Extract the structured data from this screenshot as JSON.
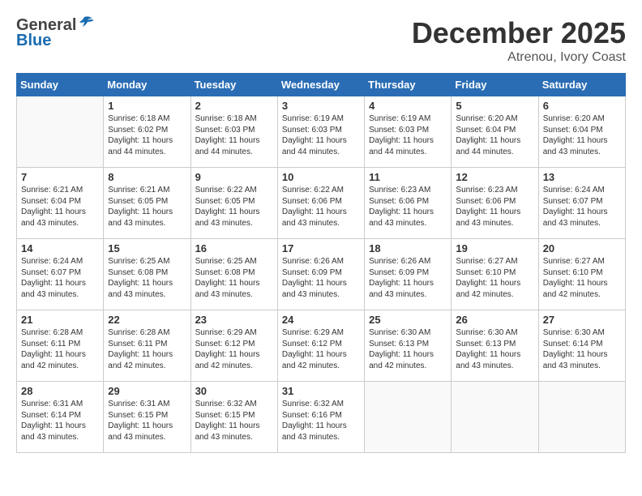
{
  "header": {
    "logo_general": "General",
    "logo_blue": "Blue",
    "month_title": "December 2025",
    "location": "Atrenou, Ivory Coast"
  },
  "days_of_week": [
    "Sunday",
    "Monday",
    "Tuesday",
    "Wednesday",
    "Thursday",
    "Friday",
    "Saturday"
  ],
  "weeks": [
    [
      {
        "day": "",
        "info": ""
      },
      {
        "day": "1",
        "info": "Sunrise: 6:18 AM\nSunset: 6:02 PM\nDaylight: 11 hours and 44 minutes."
      },
      {
        "day": "2",
        "info": "Sunrise: 6:18 AM\nSunset: 6:03 PM\nDaylight: 11 hours and 44 minutes."
      },
      {
        "day": "3",
        "info": "Sunrise: 6:19 AM\nSunset: 6:03 PM\nDaylight: 11 hours and 44 minutes."
      },
      {
        "day": "4",
        "info": "Sunrise: 6:19 AM\nSunset: 6:03 PM\nDaylight: 11 hours and 44 minutes."
      },
      {
        "day": "5",
        "info": "Sunrise: 6:20 AM\nSunset: 6:04 PM\nDaylight: 11 hours and 44 minutes."
      },
      {
        "day": "6",
        "info": "Sunrise: 6:20 AM\nSunset: 6:04 PM\nDaylight: 11 hours and 43 minutes."
      }
    ],
    [
      {
        "day": "7",
        "info": "Sunrise: 6:21 AM\nSunset: 6:04 PM\nDaylight: 11 hours and 43 minutes."
      },
      {
        "day": "8",
        "info": "Sunrise: 6:21 AM\nSunset: 6:05 PM\nDaylight: 11 hours and 43 minutes."
      },
      {
        "day": "9",
        "info": "Sunrise: 6:22 AM\nSunset: 6:05 PM\nDaylight: 11 hours and 43 minutes."
      },
      {
        "day": "10",
        "info": "Sunrise: 6:22 AM\nSunset: 6:06 PM\nDaylight: 11 hours and 43 minutes."
      },
      {
        "day": "11",
        "info": "Sunrise: 6:23 AM\nSunset: 6:06 PM\nDaylight: 11 hours and 43 minutes."
      },
      {
        "day": "12",
        "info": "Sunrise: 6:23 AM\nSunset: 6:06 PM\nDaylight: 11 hours and 43 minutes."
      },
      {
        "day": "13",
        "info": "Sunrise: 6:24 AM\nSunset: 6:07 PM\nDaylight: 11 hours and 43 minutes."
      }
    ],
    [
      {
        "day": "14",
        "info": "Sunrise: 6:24 AM\nSunset: 6:07 PM\nDaylight: 11 hours and 43 minutes."
      },
      {
        "day": "15",
        "info": "Sunrise: 6:25 AM\nSunset: 6:08 PM\nDaylight: 11 hours and 43 minutes."
      },
      {
        "day": "16",
        "info": "Sunrise: 6:25 AM\nSunset: 6:08 PM\nDaylight: 11 hours and 43 minutes."
      },
      {
        "day": "17",
        "info": "Sunrise: 6:26 AM\nSunset: 6:09 PM\nDaylight: 11 hours and 43 minutes."
      },
      {
        "day": "18",
        "info": "Sunrise: 6:26 AM\nSunset: 6:09 PM\nDaylight: 11 hours and 43 minutes."
      },
      {
        "day": "19",
        "info": "Sunrise: 6:27 AM\nSunset: 6:10 PM\nDaylight: 11 hours and 42 minutes."
      },
      {
        "day": "20",
        "info": "Sunrise: 6:27 AM\nSunset: 6:10 PM\nDaylight: 11 hours and 42 minutes."
      }
    ],
    [
      {
        "day": "21",
        "info": "Sunrise: 6:28 AM\nSunset: 6:11 PM\nDaylight: 11 hours and 42 minutes."
      },
      {
        "day": "22",
        "info": "Sunrise: 6:28 AM\nSunset: 6:11 PM\nDaylight: 11 hours and 42 minutes."
      },
      {
        "day": "23",
        "info": "Sunrise: 6:29 AM\nSunset: 6:12 PM\nDaylight: 11 hours and 42 minutes."
      },
      {
        "day": "24",
        "info": "Sunrise: 6:29 AM\nSunset: 6:12 PM\nDaylight: 11 hours and 42 minutes."
      },
      {
        "day": "25",
        "info": "Sunrise: 6:30 AM\nSunset: 6:13 PM\nDaylight: 11 hours and 42 minutes."
      },
      {
        "day": "26",
        "info": "Sunrise: 6:30 AM\nSunset: 6:13 PM\nDaylight: 11 hours and 43 minutes."
      },
      {
        "day": "27",
        "info": "Sunrise: 6:30 AM\nSunset: 6:14 PM\nDaylight: 11 hours and 43 minutes."
      }
    ],
    [
      {
        "day": "28",
        "info": "Sunrise: 6:31 AM\nSunset: 6:14 PM\nDaylight: 11 hours and 43 minutes."
      },
      {
        "day": "29",
        "info": "Sunrise: 6:31 AM\nSunset: 6:15 PM\nDaylight: 11 hours and 43 minutes."
      },
      {
        "day": "30",
        "info": "Sunrise: 6:32 AM\nSunset: 6:15 PM\nDaylight: 11 hours and 43 minutes."
      },
      {
        "day": "31",
        "info": "Sunrise: 6:32 AM\nSunset: 6:16 PM\nDaylight: 11 hours and 43 minutes."
      },
      {
        "day": "",
        "info": ""
      },
      {
        "day": "",
        "info": ""
      },
      {
        "day": "",
        "info": ""
      }
    ]
  ]
}
